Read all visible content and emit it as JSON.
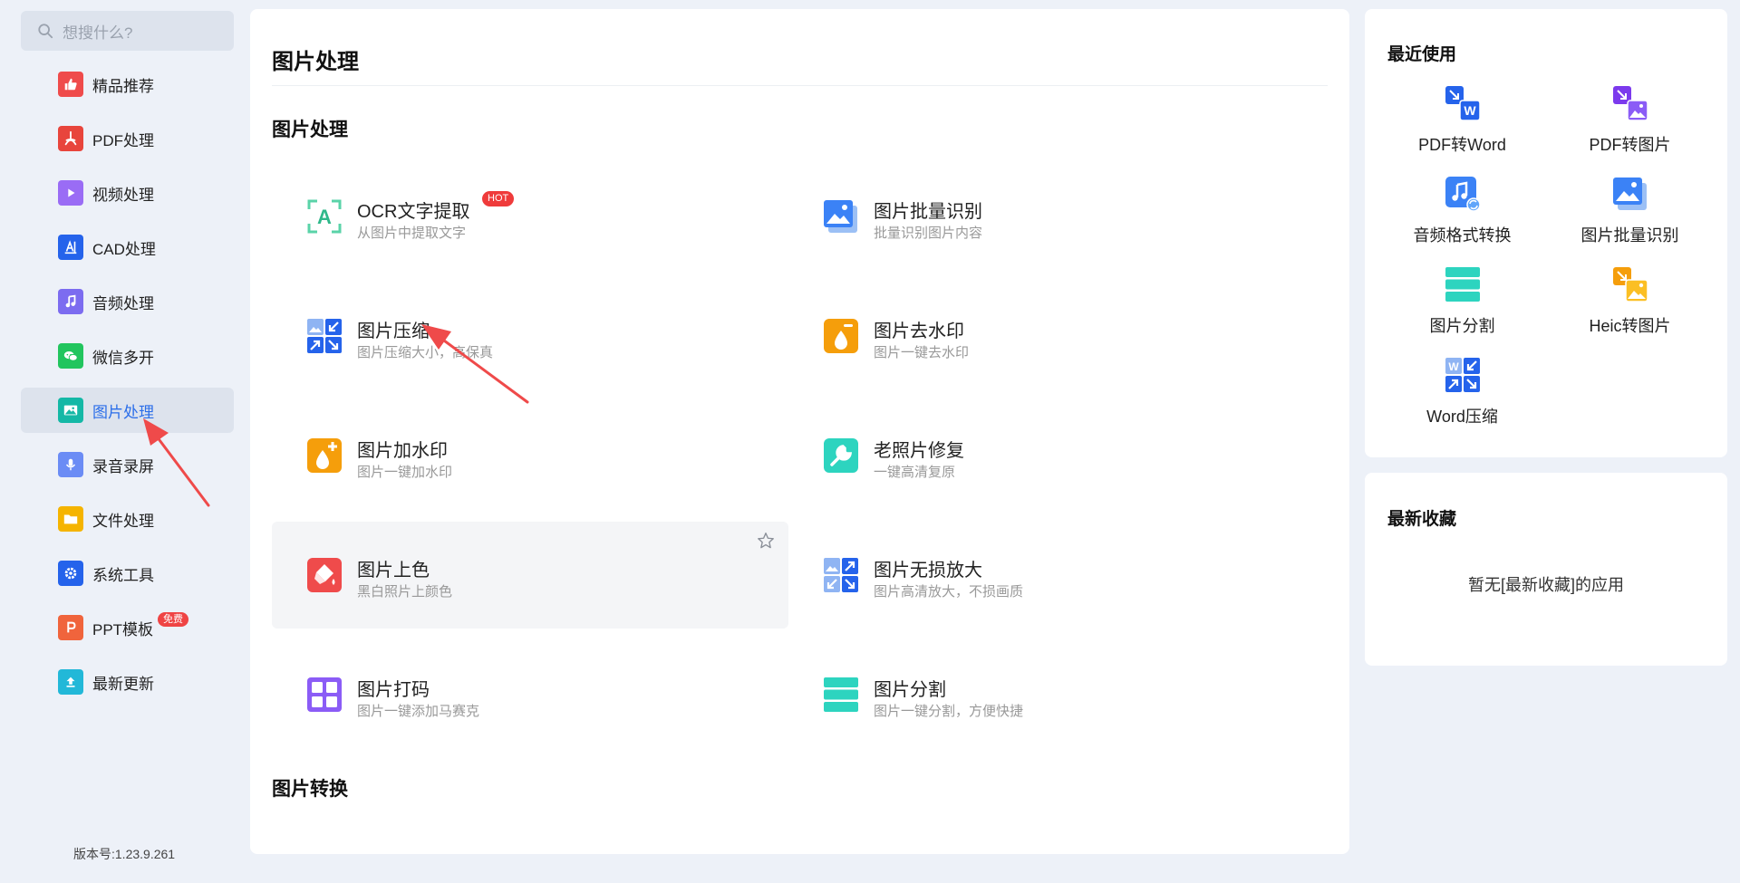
{
  "search": {
    "placeholder": "想搜什么?"
  },
  "sidebar": {
    "items": [
      {
        "label": "精品推荐",
        "icon": "thumbs-up-icon",
        "color": "#ef4b4b"
      },
      {
        "label": "PDF处理",
        "icon": "pdf-icon",
        "color": "#e8453c"
      },
      {
        "label": "视频处理",
        "icon": "play-icon",
        "color": "#8b5cf6"
      },
      {
        "label": "CAD处理",
        "icon": "cad-icon",
        "color": "#2563eb"
      },
      {
        "label": "音频处理",
        "icon": "music-note-icon",
        "color": "#7c6cf0"
      },
      {
        "label": "微信多开",
        "icon": "wechat-icon",
        "color": "#22c55e"
      },
      {
        "label": "图片处理",
        "icon": "image-icon",
        "color": "#14b8a6",
        "active": true
      },
      {
        "label": "录音录屏",
        "icon": "microphone-icon",
        "color": "#6b8cf5"
      },
      {
        "label": "文件处理",
        "icon": "folder-icon",
        "color": "#f5b400"
      },
      {
        "label": "系统工具",
        "icon": "gear-icon",
        "color": "#2563eb"
      },
      {
        "label": "PPT模板",
        "icon": "ppt-icon",
        "color": "#f0643c",
        "badge": "免费"
      },
      {
        "label": "最新更新",
        "icon": "upload-icon",
        "color": "#22b8d8"
      }
    ],
    "version": "版本号:1.23.9.261"
  },
  "main": {
    "title": "图片处理",
    "section1": "图片处理",
    "section2": "图片转换",
    "tools": [
      {
        "name": "OCR文字提取",
        "desc": "从图片中提取文字",
        "icon": "ocr-icon",
        "hot": "HOT"
      },
      {
        "name": "图片批量识别",
        "desc": "批量识别图片内容",
        "icon": "image-batch-icon"
      },
      {
        "name": "图片压缩",
        "desc": "图片压缩大小，高保真",
        "icon": "compress-icon"
      },
      {
        "name": "图片去水印",
        "desc": "图片一键去水印",
        "icon": "remove-watermark-icon"
      },
      {
        "name": "图片加水印",
        "desc": "图片一键加水印",
        "icon": "add-watermark-icon"
      },
      {
        "name": "老照片修复",
        "desc": "一键高清复原",
        "icon": "photo-repair-icon"
      },
      {
        "name": "图片上色",
        "desc": "黑白照片上颜色",
        "icon": "colorize-icon"
      },
      {
        "name": "图片无损放大",
        "desc": "图片高清放大，不损画质",
        "icon": "upscale-icon"
      },
      {
        "name": "图片打码",
        "desc": "图片一键添加马赛克",
        "icon": "mosaic-icon"
      },
      {
        "name": "图片分割",
        "desc": "图片一键分割，方便快捷",
        "icon": "split-icon"
      }
    ]
  },
  "recent": {
    "title": "最近使用",
    "items": [
      {
        "label": "PDF转Word",
        "icon": "pdf-to-word-icon"
      },
      {
        "label": "PDF转图片",
        "icon": "pdf-to-image-icon"
      },
      {
        "label": "音频格式转换",
        "icon": "audio-convert-icon"
      },
      {
        "label": "图片批量识别",
        "icon": "image-batch-icon"
      },
      {
        "label": "图片分割",
        "icon": "split-icon"
      },
      {
        "label": "Heic转图片",
        "icon": "heic-icon"
      },
      {
        "label": "Word压缩",
        "icon": "word-compress-icon"
      }
    ]
  },
  "favorites": {
    "title": "最新收藏",
    "empty": "暂无[最新收藏]的应用"
  }
}
